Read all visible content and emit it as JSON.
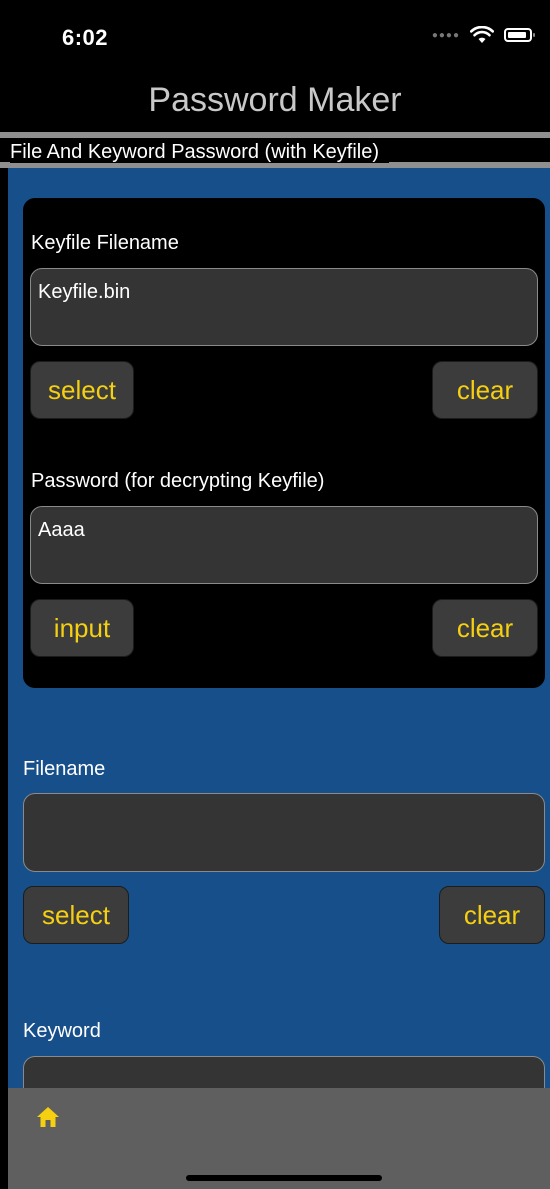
{
  "status": {
    "time": "6:02"
  },
  "header": {
    "title": "Password Maker"
  },
  "mode": {
    "label": "File And Keyword Password (with Keyfile)"
  },
  "keyfile_section": {
    "filename_label": "Keyfile Filename",
    "filename_value": "Keyfile.bin",
    "select_label": "select",
    "clear_label": "clear",
    "password_label": "Password (for decrypting Keyfile)",
    "password_value": "Aaaa",
    "input_label": "input",
    "clear2_label": "clear"
  },
  "file_section": {
    "filename_label": "Filename",
    "filename_value": "",
    "select_label": "select",
    "clear_label": "clear"
  },
  "keyword_section": {
    "keyword_label": "Keyword",
    "keyword_value": ""
  },
  "tab_bar": {
    "icon": "home-icon"
  },
  "colors": {
    "accent": "#f5cf11",
    "background": "#164f8a",
    "panel": "#000000",
    "field": "#343434"
  }
}
